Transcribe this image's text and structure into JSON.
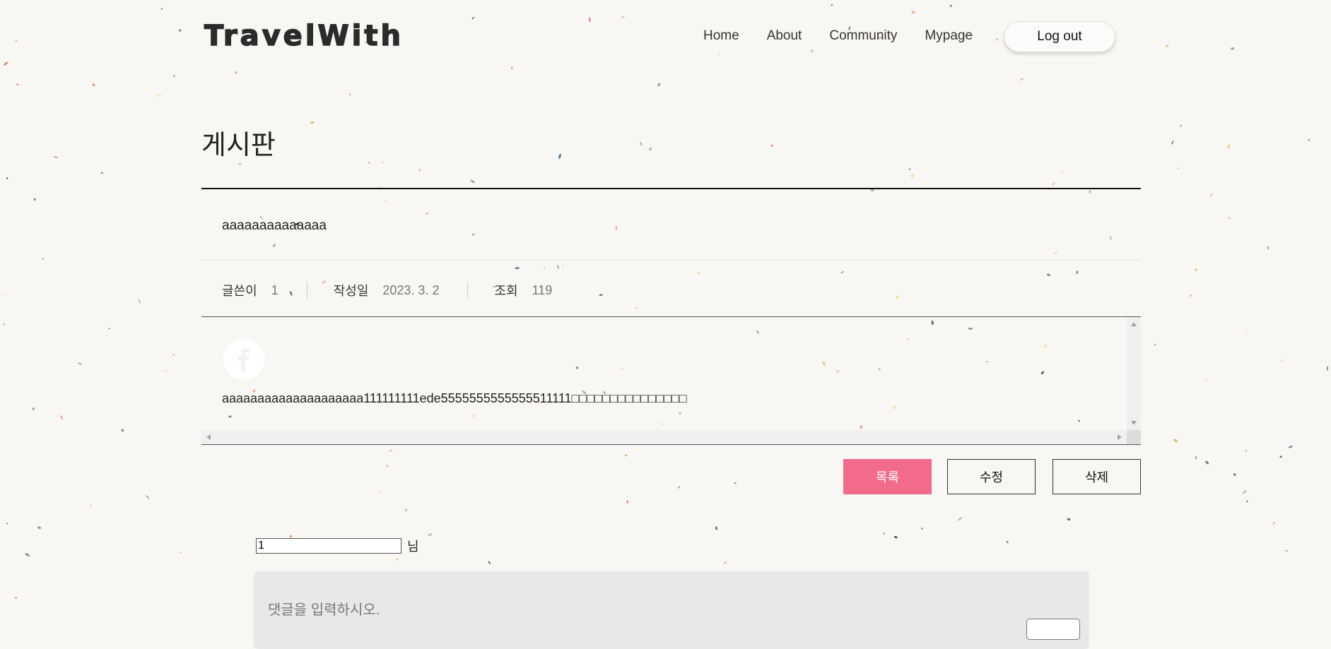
{
  "header": {
    "logo": "TravelWith",
    "nav": [
      "Home",
      "About",
      "Community",
      "Mypage"
    ],
    "logout_label": "Log out"
  },
  "board": {
    "title": "게시판"
  },
  "post": {
    "title": "aaaaaaaaaaaaaa",
    "meta": {
      "writer_label": "글쓴이",
      "writer": "1",
      "date_label": "작성일",
      "date": "2023. 3. 2",
      "views_label": "조회",
      "views": "119"
    },
    "content": "aaaaaaaaaaaaaaaaaaaa111111111ede5555555555555511111□□□□□□□□□□□□□□□",
    "content_icon": "facebook-icon"
  },
  "actions": {
    "list_label": "목록",
    "edit_label": "수정",
    "delete_label": "삭제"
  },
  "comment": {
    "writer_value": "1",
    "writer_suffix": "님",
    "placeholder": "댓글을 입력하시오."
  },
  "colors": {
    "accent": "#f36b8b",
    "background": "#f8f7f3"
  }
}
